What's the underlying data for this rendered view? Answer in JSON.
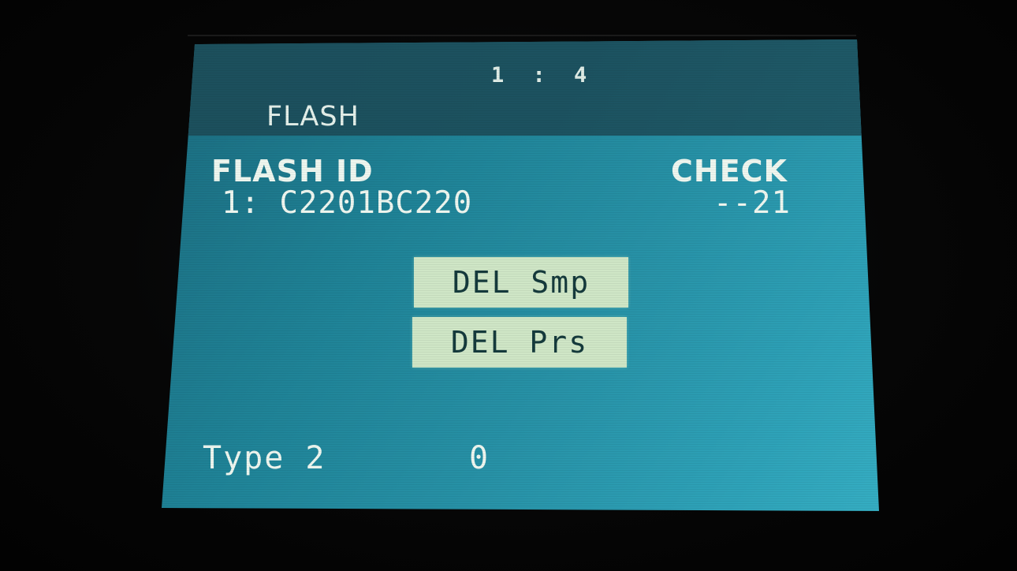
{
  "screen": {
    "page_indicator": "1 : 4",
    "title": "FLASH",
    "flash_id": {
      "label": "FLASH ID",
      "value": "1: C2201BC220"
    },
    "check": {
      "label": "CHECK",
      "value": "--21"
    },
    "buttons": {
      "delete_samples": "DEL Smp",
      "delete_presets": "DEL Prs"
    },
    "type": {
      "label": "Type 2",
      "value": "0"
    }
  },
  "colors": {
    "screen_bg": "#2791a6",
    "header_bg": "#1c5260",
    "button_bg": "#cfe6c6",
    "button_text": "#153a3c",
    "text": "#eef6ef"
  }
}
